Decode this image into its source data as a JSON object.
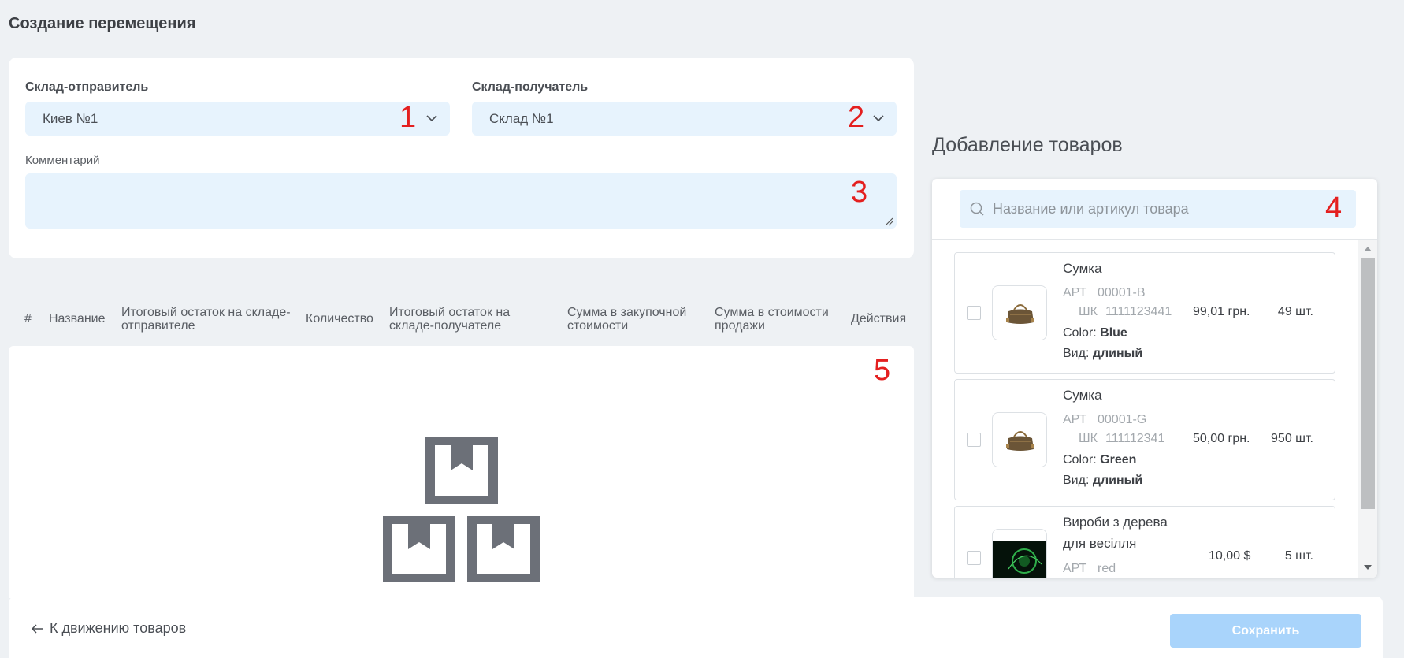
{
  "page": {
    "title": "Создание перемещения"
  },
  "form": {
    "sender_label": "Склад-отправитель",
    "sender_value": "Киев №1",
    "receiver_label": "Склад-получатель",
    "receiver_value": "Склад №1",
    "comment_label": "Комментарий",
    "comment_value": ""
  },
  "annotations": [
    "1",
    "2",
    "3",
    "4",
    "5"
  ],
  "table": {
    "columns": [
      "#",
      "Название",
      "Итоговый остаток на складе-отправителе",
      "Количество",
      "Итоговый остаток на складе-получателе",
      "Сумма в закупочной стоимости",
      "Сумма в стоимости продажи",
      "Действия"
    ],
    "rows": []
  },
  "products_panel": {
    "title": "Добавление товаров",
    "search_placeholder": "Название или артикул товара",
    "items": [
      {
        "name": "Сумка",
        "art_label": "АРТ",
        "art": "00001-B",
        "barcode_label": "ШК",
        "barcode": "1111123441",
        "price": "99,01 грн.",
        "qty": "49 шт.",
        "color_label": "Color:",
        "color": "Blue",
        "kind_label": "Вид:",
        "kind": "длиный",
        "image": "bag"
      },
      {
        "name": "Сумка",
        "art_label": "АРТ",
        "art": "00001-G",
        "barcode_label": "ШК",
        "barcode": "111112341",
        "price": "50,00 грн.",
        "qty": "950 шт.",
        "color_label": "Color:",
        "color": "Green",
        "kind_label": "Вид:",
        "kind": "длиный",
        "image": "bag"
      },
      {
        "name": "Вироби з дерева для весілля",
        "art_label": "АРТ",
        "art": "red",
        "price": "10,00 $",
        "qty": "5 шт.",
        "image": "dark-green"
      }
    ]
  },
  "footer": {
    "back_label": "К движению товаров",
    "save_label": "Сохранить"
  },
  "colors": {
    "accent_light": "#a9d4fb",
    "input_bg": "#e7f3fd",
    "annotation_red": "#e41f1f",
    "page_bg": "#eef1f4"
  }
}
